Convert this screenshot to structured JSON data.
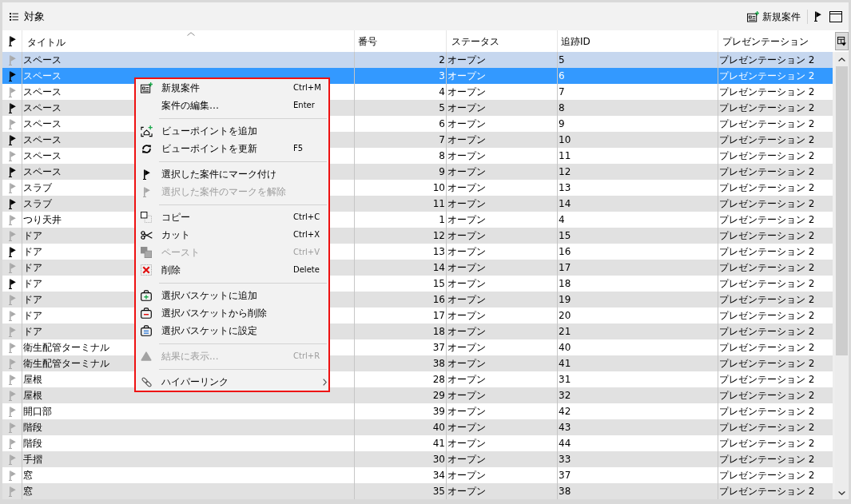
{
  "panel": {
    "title": "対象",
    "new_button": "新規案件"
  },
  "table": {
    "columns": [
      {
        "label": "タイトル",
        "sorted": true
      },
      {
        "label": "番号",
        "sorted": false
      },
      {
        "label": "ステータス",
        "sorted": false
      },
      {
        "label": "追跡ID",
        "sorted": false
      },
      {
        "label": "プレゼンテーション",
        "sorted": false
      }
    ],
    "rows": [
      {
        "flagged": false,
        "title": "スペース",
        "number": "2",
        "status": "オープン",
        "tracking_id": "5",
        "presentation": "プレゼンテーション 2",
        "selected": false,
        "hovered": true
      },
      {
        "flagged": true,
        "title": "スペース",
        "number": "3",
        "status": "オープン",
        "tracking_id": "6",
        "presentation": "プレゼンテーション 2",
        "selected": true,
        "hovered": false
      },
      {
        "flagged": false,
        "title": "スペース",
        "number": "4",
        "status": "オープン",
        "tracking_id": "7",
        "presentation": "プレゼンテーション 2",
        "selected": false,
        "hovered": false
      },
      {
        "flagged": true,
        "title": "スペース",
        "number": "5",
        "status": "オープン",
        "tracking_id": "8",
        "presentation": "プレゼンテーション 2",
        "selected": false,
        "hovered": false
      },
      {
        "flagged": false,
        "title": "スペース",
        "number": "6",
        "status": "オープン",
        "tracking_id": "9",
        "presentation": "プレゼンテーション 2",
        "selected": false,
        "hovered": false
      },
      {
        "flagged": true,
        "title": "スペース",
        "number": "7",
        "status": "オープン",
        "tracking_id": "10",
        "presentation": "プレゼンテーション 2",
        "selected": false,
        "hovered": false
      },
      {
        "flagged": false,
        "title": "スペース",
        "number": "8",
        "status": "オープン",
        "tracking_id": "11",
        "presentation": "プレゼンテーション 2",
        "selected": false,
        "hovered": false
      },
      {
        "flagged": true,
        "title": "スペース",
        "number": "9",
        "status": "オープン",
        "tracking_id": "12",
        "presentation": "プレゼンテーション 2",
        "selected": false,
        "hovered": false
      },
      {
        "flagged": false,
        "title": "スラブ",
        "number": "10",
        "status": "オープン",
        "tracking_id": "13",
        "presentation": "プレゼンテーション 2",
        "selected": false,
        "hovered": false
      },
      {
        "flagged": true,
        "title": "スラブ",
        "number": "11",
        "status": "オープン",
        "tracking_id": "14",
        "presentation": "プレゼンテーション 2",
        "selected": false,
        "hovered": false
      },
      {
        "flagged": false,
        "title": "つり天井",
        "number": "1",
        "status": "オープン",
        "tracking_id": "4",
        "presentation": "プレゼンテーション 2",
        "selected": false,
        "hovered": false
      },
      {
        "flagged": false,
        "title": "ドア",
        "number": "12",
        "status": "オープン",
        "tracking_id": "15",
        "presentation": "プレゼンテーション 2",
        "selected": false,
        "hovered": false
      },
      {
        "flagged": true,
        "title": "ドア",
        "number": "13",
        "status": "オープン",
        "tracking_id": "16",
        "presentation": "プレゼンテーション 2",
        "selected": false,
        "hovered": false
      },
      {
        "flagged": false,
        "title": "ドア",
        "number": "14",
        "status": "オープン",
        "tracking_id": "17",
        "presentation": "プレゼンテーション 2",
        "selected": false,
        "hovered": false
      },
      {
        "flagged": true,
        "title": "ドア",
        "number": "15",
        "status": "オープン",
        "tracking_id": "18",
        "presentation": "プレゼンテーション 2",
        "selected": false,
        "hovered": false
      },
      {
        "flagged": false,
        "title": "ドア",
        "number": "16",
        "status": "オープン",
        "tracking_id": "19",
        "presentation": "プレゼンテーション 2",
        "selected": false,
        "hovered": false
      },
      {
        "flagged": false,
        "title": "ドア",
        "number": "17",
        "status": "オープン",
        "tracking_id": "20",
        "presentation": "プレゼンテーション 2",
        "selected": false,
        "hovered": false
      },
      {
        "flagged": false,
        "title": "ドア",
        "number": "18",
        "status": "オープン",
        "tracking_id": "21",
        "presentation": "プレゼンテーション 2",
        "selected": false,
        "hovered": false
      },
      {
        "flagged": false,
        "title": "衛生配管ターミナル",
        "number": "37",
        "status": "オープン",
        "tracking_id": "40",
        "presentation": "プレゼンテーション 2",
        "selected": false,
        "hovered": false
      },
      {
        "flagged": false,
        "title": "衛生配管ターミナル",
        "number": "38",
        "status": "オープン",
        "tracking_id": "41",
        "presentation": "プレゼンテーション 2",
        "selected": false,
        "hovered": false
      },
      {
        "flagged": false,
        "title": "屋根",
        "number": "28",
        "status": "オープン",
        "tracking_id": "31",
        "presentation": "プレゼンテーション 2",
        "selected": false,
        "hovered": false
      },
      {
        "flagged": false,
        "title": "屋根",
        "number": "29",
        "status": "オープン",
        "tracking_id": "32",
        "presentation": "プレゼンテーション 2",
        "selected": false,
        "hovered": false
      },
      {
        "flagged": false,
        "title": "開口部",
        "number": "39",
        "status": "オープン",
        "tracking_id": "42",
        "presentation": "プレゼンテーション 2",
        "selected": false,
        "hovered": false
      },
      {
        "flagged": false,
        "title": "階段",
        "number": "40",
        "status": "オープン",
        "tracking_id": "43",
        "presentation": "プレゼンテーション 2",
        "selected": false,
        "hovered": false
      },
      {
        "flagged": false,
        "title": "階段",
        "number": "41",
        "status": "オープン",
        "tracking_id": "44",
        "presentation": "プレゼンテーション 2",
        "selected": false,
        "hovered": false
      },
      {
        "flagged": false,
        "title": "手摺",
        "number": "30",
        "status": "オープン",
        "tracking_id": "33",
        "presentation": "プレゼンテーション 2",
        "selected": false,
        "hovered": false
      },
      {
        "flagged": false,
        "title": "窓",
        "number": "34",
        "status": "オープン",
        "tracking_id": "37",
        "presentation": "プレゼンテーション 2",
        "selected": false,
        "hovered": false
      },
      {
        "flagged": false,
        "title": "窓",
        "number": "35",
        "status": "オープン",
        "tracking_id": "38",
        "presentation": "プレゼンテーション 2",
        "selected": false,
        "hovered": false
      }
    ]
  },
  "context_menu": {
    "groups": [
      [
        {
          "label": "新規案件",
          "shortcut": "Ctrl+M",
          "disabled": false,
          "submenu": false
        },
        {
          "label": "案件の編集…",
          "shortcut": "Enter",
          "disabled": false,
          "submenu": false
        }
      ],
      [
        {
          "label": "ビューポイントを追加",
          "disabled": false,
          "submenu": false
        },
        {
          "label": "ビューポイントを更新",
          "shortcut": "F5",
          "disabled": false,
          "submenu": false
        }
      ],
      [
        {
          "label": "選択した案件にマーク付け",
          "disabled": false,
          "submenu": false
        },
        {
          "label": "選択した案件のマークを解除",
          "disabled": true,
          "submenu": false
        }
      ],
      [
        {
          "label": "コピー",
          "shortcut": "Ctrl+C",
          "disabled": false,
          "submenu": false
        },
        {
          "label": "カット",
          "shortcut": "Ctrl+X",
          "disabled": false,
          "submenu": false
        },
        {
          "label": "ペースト",
          "shortcut": "Ctrl+V",
          "disabled": true,
          "submenu": false
        },
        {
          "label": "削除",
          "shortcut": "Delete",
          "disabled": false,
          "submenu": false
        }
      ],
      [
        {
          "label": "選択バスケットに追加",
          "disabled": false,
          "submenu": false
        },
        {
          "label": "選択バスケットから削除",
          "disabled": false,
          "submenu": false
        },
        {
          "label": "選択バスケットに設定",
          "disabled": false,
          "submenu": false
        }
      ],
      [
        {
          "label": "結果に表示...",
          "shortcut": "Ctrl+R",
          "disabled": true,
          "submenu": false
        }
      ],
      [
        {
          "label": "ハイパーリンク",
          "disabled": false,
          "submenu": true
        }
      ]
    ]
  }
}
